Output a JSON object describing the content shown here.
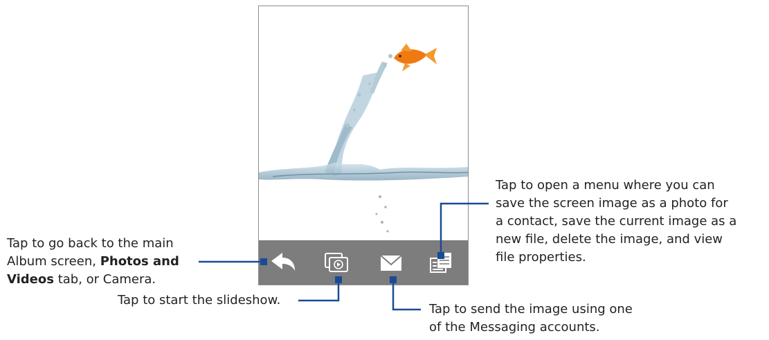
{
  "toolbar": {
    "back_icon": "back-arrow-icon",
    "slideshow_icon": "slideshow-icon",
    "send_icon": "envelope-icon",
    "menu_icon": "menu-list-icon"
  },
  "callouts": {
    "back": {
      "line1": "Tap to go back to the main",
      "line2_a": "Album screen, ",
      "line2_b": "Photos and",
      "line3_a": "Videos",
      "line3_b": " tab, or Camera."
    },
    "slideshow": "Tap to start the slideshow.",
    "send": {
      "line1": "Tap to send the image using one",
      "line2": "of the Messaging accounts."
    },
    "menu": {
      "line1": "Tap to open a menu where you can",
      "line2": "save the screen image as a photo for",
      "line3": "a contact, save the current image as a",
      "line4": "new file, delete the image, and view",
      "line5": "file properties."
    }
  },
  "colors": {
    "toolbar": "#7d7d7d",
    "callout_line": "#1a4a96"
  }
}
